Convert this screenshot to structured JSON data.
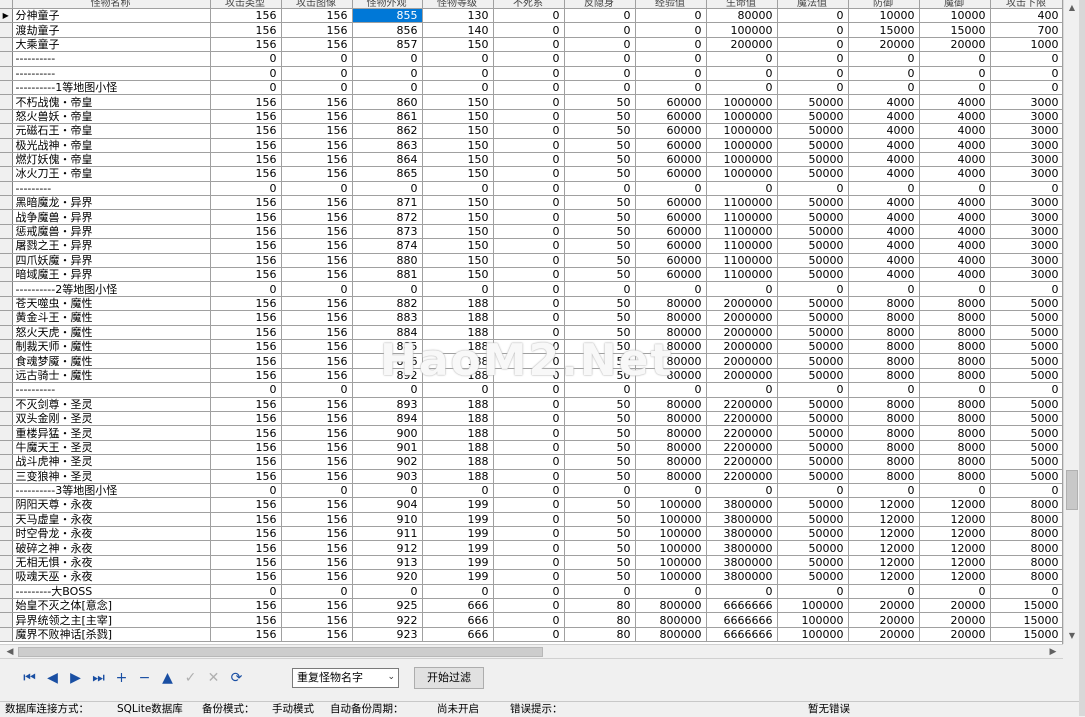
{
  "grid": {
    "columns": [
      "",
      "怪物名称",
      "攻击类型",
      "攻击图像",
      "怪物外观",
      "怪物等级",
      "不死系",
      "反隐身",
      "经验值",
      "生命值",
      "魔法值",
      "防御",
      "魔御",
      "攻击下限"
    ],
    "rows": [
      [
        "分神童子",
        "156",
        "156",
        "855",
        "130",
        "0",
        "0",
        "0",
        "80000",
        "0",
        "10000",
        "10000",
        "400"
      ],
      [
        "渡劫童子",
        "156",
        "156",
        "856",
        "140",
        "0",
        "0",
        "0",
        "100000",
        "0",
        "15000",
        "15000",
        "700"
      ],
      [
        "大乘童子",
        "156",
        "156",
        "857",
        "150",
        "0",
        "0",
        "0",
        "200000",
        "0",
        "20000",
        "20000",
        "1000"
      ],
      [
        "----------",
        "0",
        "0",
        "0",
        "0",
        "0",
        "0",
        "0",
        "0",
        "0",
        "0",
        "0",
        "0"
      ],
      [
        "----------",
        "0",
        "0",
        "0",
        "0",
        "0",
        "0",
        "0",
        "0",
        "0",
        "0",
        "0",
        "0"
      ],
      [
        "----------1等地图小怪",
        "0",
        "0",
        "0",
        "0",
        "0",
        "0",
        "0",
        "0",
        "0",
        "0",
        "0",
        "0"
      ],
      [
        "不朽战傀・帝皇",
        "156",
        "156",
        "860",
        "150",
        "0",
        "50",
        "60000",
        "1000000",
        "50000",
        "4000",
        "4000",
        "3000"
      ],
      [
        "怒火兽妖・帝皇",
        "156",
        "156",
        "861",
        "150",
        "0",
        "50",
        "60000",
        "1000000",
        "50000",
        "4000",
        "4000",
        "3000"
      ],
      [
        "元磁石王・帝皇",
        "156",
        "156",
        "862",
        "150",
        "0",
        "50",
        "60000",
        "1000000",
        "50000",
        "4000",
        "4000",
        "3000"
      ],
      [
        "极光战神・帝皇",
        "156",
        "156",
        "863",
        "150",
        "0",
        "50",
        "60000",
        "1000000",
        "50000",
        "4000",
        "4000",
        "3000"
      ],
      [
        "燃灯妖傀・帝皇",
        "156",
        "156",
        "864",
        "150",
        "0",
        "50",
        "60000",
        "1000000",
        "50000",
        "4000",
        "4000",
        "3000"
      ],
      [
        "冰火刀王・帝皇",
        "156",
        "156",
        "865",
        "150",
        "0",
        "50",
        "60000",
        "1000000",
        "50000",
        "4000",
        "4000",
        "3000"
      ],
      [
        "---------",
        "0",
        "0",
        "0",
        "0",
        "0",
        "0",
        "0",
        "0",
        "0",
        "0",
        "0",
        "0"
      ],
      [
        "黑暗魔龙・异界",
        "156",
        "156",
        "871",
        "150",
        "0",
        "50",
        "60000",
        "1100000",
        "50000",
        "4000",
        "4000",
        "3000"
      ],
      [
        "战争魔兽・异界",
        "156",
        "156",
        "872",
        "150",
        "0",
        "50",
        "60000",
        "1100000",
        "50000",
        "4000",
        "4000",
        "3000"
      ],
      [
        "惩戒魔兽・异界",
        "156",
        "156",
        "873",
        "150",
        "0",
        "50",
        "60000",
        "1100000",
        "50000",
        "4000",
        "4000",
        "3000"
      ],
      [
        "屠戮之王・异界",
        "156",
        "156",
        "874",
        "150",
        "0",
        "50",
        "60000",
        "1100000",
        "50000",
        "4000",
        "4000",
        "3000"
      ],
      [
        "四爪妖魔・异界",
        "156",
        "156",
        "880",
        "150",
        "0",
        "50",
        "60000",
        "1100000",
        "50000",
        "4000",
        "4000",
        "3000"
      ],
      [
        "暗域魔王・异界",
        "156",
        "156",
        "881",
        "150",
        "0",
        "50",
        "60000",
        "1100000",
        "50000",
        "4000",
        "4000",
        "3000"
      ],
      [
        "----------2等地图小怪",
        "0",
        "0",
        "0",
        "0",
        "0",
        "0",
        "0",
        "0",
        "0",
        "0",
        "0",
        "0"
      ],
      [
        "苍天噬虫・魔性",
        "156",
        "156",
        "882",
        "188",
        "0",
        "50",
        "80000",
        "2000000",
        "50000",
        "8000",
        "8000",
        "5000"
      ],
      [
        "黄金斗王・魔性",
        "156",
        "156",
        "883",
        "188",
        "0",
        "50",
        "80000",
        "2000000",
        "50000",
        "8000",
        "8000",
        "5000"
      ],
      [
        "怒火天虎・魔性",
        "156",
        "156",
        "884",
        "188",
        "0",
        "50",
        "80000",
        "2000000",
        "50000",
        "8000",
        "8000",
        "5000"
      ],
      [
        "制裁天师・魔性",
        "156",
        "156",
        "885",
        "188",
        "0",
        "50",
        "80000",
        "2000000",
        "50000",
        "8000",
        "8000",
        "5000"
      ],
      [
        "食魂梦魇・魔性",
        "156",
        "156",
        "886",
        "188",
        "0",
        "50",
        "80000",
        "2000000",
        "50000",
        "8000",
        "8000",
        "5000"
      ],
      [
        "远古骑士・魔性",
        "156",
        "156",
        "892",
        "188",
        "0",
        "50",
        "80000",
        "2000000",
        "50000",
        "8000",
        "8000",
        "5000"
      ],
      [
        "----------",
        "0",
        "0",
        "0",
        "0",
        "0",
        "0",
        "0",
        "0",
        "0",
        "0",
        "0",
        "0"
      ],
      [
        "不灭剑尊・圣灵",
        "156",
        "156",
        "893",
        "188",
        "0",
        "50",
        "80000",
        "2200000",
        "50000",
        "8000",
        "8000",
        "5000"
      ],
      [
        "双头金刚・圣灵",
        "156",
        "156",
        "894",
        "188",
        "0",
        "50",
        "80000",
        "2200000",
        "50000",
        "8000",
        "8000",
        "5000"
      ],
      [
        "重楼异猛・圣灵",
        "156",
        "156",
        "900",
        "188",
        "0",
        "50",
        "80000",
        "2200000",
        "50000",
        "8000",
        "8000",
        "5000"
      ],
      [
        "牛魔天王・圣灵",
        "156",
        "156",
        "901",
        "188",
        "0",
        "50",
        "80000",
        "2200000",
        "50000",
        "8000",
        "8000",
        "5000"
      ],
      [
        "战斗虎神・圣灵",
        "156",
        "156",
        "902",
        "188",
        "0",
        "50",
        "80000",
        "2200000",
        "50000",
        "8000",
        "8000",
        "5000"
      ],
      [
        "三变狼神・圣灵",
        "156",
        "156",
        "903",
        "188",
        "0",
        "50",
        "80000",
        "2200000",
        "50000",
        "8000",
        "8000",
        "5000"
      ],
      [
        "----------3等地图小怪",
        "0",
        "0",
        "0",
        "0",
        "0",
        "0",
        "0",
        "0",
        "0",
        "0",
        "0",
        "0"
      ],
      [
        "阴阳天尊・永夜",
        "156",
        "156",
        "904",
        "199",
        "0",
        "50",
        "100000",
        "3800000",
        "50000",
        "12000",
        "12000",
        "8000"
      ],
      [
        "天马虚皇・永夜",
        "156",
        "156",
        "910",
        "199",
        "0",
        "50",
        "100000",
        "3800000",
        "50000",
        "12000",
        "12000",
        "8000"
      ],
      [
        "时空骨龙・永夜",
        "156",
        "156",
        "911",
        "199",
        "0",
        "50",
        "100000",
        "3800000",
        "50000",
        "12000",
        "12000",
        "8000"
      ],
      [
        "破碎之神・永夜",
        "156",
        "156",
        "912",
        "199",
        "0",
        "50",
        "100000",
        "3800000",
        "50000",
        "12000",
        "12000",
        "8000"
      ],
      [
        "无相无惧・永夜",
        "156",
        "156",
        "913",
        "199",
        "0",
        "50",
        "100000",
        "3800000",
        "50000",
        "12000",
        "12000",
        "8000"
      ],
      [
        "吸魂天巫・永夜",
        "156",
        "156",
        "920",
        "199",
        "0",
        "50",
        "100000",
        "3800000",
        "50000",
        "12000",
        "12000",
        "8000"
      ],
      [
        "---------大BOSS",
        "0",
        "0",
        "0",
        "0",
        "0",
        "0",
        "0",
        "0",
        "0",
        "0",
        "0",
        "0"
      ],
      [
        "始皇不灭之体[意念]",
        "156",
        "156",
        "925",
        "666",
        "0",
        "80",
        "800000",
        "6666666",
        "100000",
        "20000",
        "20000",
        "15000"
      ],
      [
        "异界统领之主[主宰]",
        "156",
        "156",
        "922",
        "666",
        "0",
        "80",
        "800000",
        "6666666",
        "100000",
        "20000",
        "20000",
        "15000"
      ],
      [
        "魔界不败神话[杀戮]",
        "156",
        "156",
        "923",
        "666",
        "0",
        "80",
        "800000",
        "6666666",
        "100000",
        "20000",
        "20000",
        "15000"
      ]
    ]
  },
  "nav": {
    "icons": [
      "first-record-icon",
      "prior-record-icon",
      "next-record-icon",
      "last-record-icon",
      "insert-record-icon",
      "delete-record-icon",
      "edit-record-icon",
      "post-edit-icon",
      "cancel-edit-icon",
      "refresh-data-icon"
    ],
    "glyphs": [
      "⏮",
      "◀",
      "▶",
      "⏭",
      "+",
      "−",
      "▲",
      "✓",
      "✕",
      "⟳"
    ]
  },
  "filter": {
    "selected": "重复怪物名字",
    "button_label": "开始过滤"
  },
  "status": {
    "connection_label": "数据库连接方式：",
    "connection_value": "SQLite数据库",
    "backup_mode_label": "备份模式：",
    "backup_mode_value": "手动模式",
    "auto_backup_label": "自动备份周期：",
    "auto_backup_value": "尚未开启",
    "error_label": "错误提示：",
    "error_value": "暂无错误"
  },
  "watermark": "HaoM2.Net"
}
